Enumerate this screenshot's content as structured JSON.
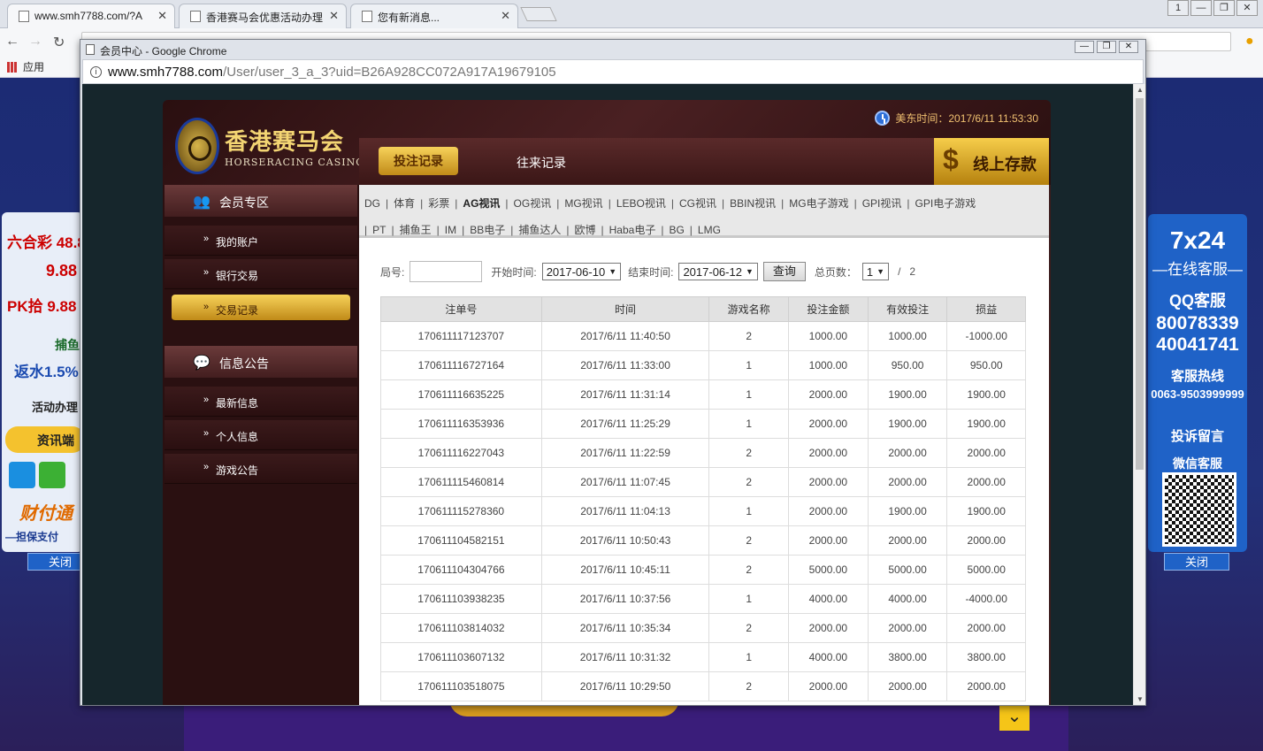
{
  "browser": {
    "tabs": [
      {
        "title": "www.smh7788.com/?A",
        "close": "✕"
      },
      {
        "title": "香港赛马会优惠活动办理",
        "close": "✕"
      },
      {
        "title": "您有新消息...",
        "close": "✕"
      }
    ],
    "bookmarks": {
      "apps_label": "应用"
    }
  },
  "popup": {
    "title": "会员中心 - Google Chrome",
    "url_host": "www.smh7788.com",
    "url_path": "/User/user_3_a_3?uid=B26A928CC072A917A19679105"
  },
  "header": {
    "logo_cn": "香港赛马会",
    "logo_en": "HORSERACING CASINO",
    "clock_text": "美东时间：2017/6/11 11:53:30",
    "tab_active": "投注记录",
    "tab_other": "往来记录",
    "deposit_label": "线上存款",
    "deposit_symbol": "$"
  },
  "sidebar": {
    "section1": "会员专区",
    "items1": [
      {
        "label": "我的账户",
        "arrow": "»"
      },
      {
        "label": "银行交易",
        "arrow": "»"
      },
      {
        "label": "交易记录",
        "arrow": "»"
      }
    ],
    "section2": "信息公告",
    "items2": [
      {
        "label": "最新信息",
        "arrow": "»"
      },
      {
        "label": "个人信息",
        "arrow": "»"
      },
      {
        "label": "游戏公告",
        "arrow": "»"
      }
    ]
  },
  "categories": [
    "DG",
    "体育",
    "彩票",
    "AG视讯",
    "OG视讯",
    "MG视讯",
    "LEBO视讯",
    "CG视讯",
    "BBIN视讯",
    "MG电子游戏",
    "GPI视讯",
    "GPI电子游戏",
    "PT",
    "捕鱼王",
    "IM",
    "BB电子",
    "捕鱼达人",
    "欧博",
    "Haba电子",
    "BG",
    "LMG"
  ],
  "category_sep": "|",
  "filter": {
    "round_label": "局号:",
    "start_label": "开始时间:",
    "start_value": "2017-06-10",
    "end_label": "结束时间:",
    "end_value": "2017-06-12",
    "query_button": "查询",
    "pages_label": "总页数：",
    "page_value": "1",
    "page_sep": "/",
    "page_total": "2",
    "dropdown_arrow": "▼"
  },
  "table": {
    "headers": [
      "注单号",
      "时间",
      "游戏名称",
      "投注金额",
      "有效投注",
      "损益"
    ],
    "rows": [
      [
        "170611117123707",
        "2017/6/11 11:40:50",
        "2",
        "1000.00",
        "1000.00",
        "-1000.00"
      ],
      [
        "170611116727164",
        "2017/6/11 11:33:00",
        "1",
        "1000.00",
        "950.00",
        "950.00"
      ],
      [
        "170611116635225",
        "2017/6/11 11:31:14",
        "1",
        "2000.00",
        "1900.00",
        "1900.00"
      ],
      [
        "170611116353936",
        "2017/6/11 11:25:29",
        "1",
        "2000.00",
        "1900.00",
        "1900.00"
      ],
      [
        "170611116227043",
        "2017/6/11 11:22:59",
        "2",
        "2000.00",
        "2000.00",
        "2000.00"
      ],
      [
        "170611115460814",
        "2017/6/11 11:07:45",
        "2",
        "2000.00",
        "2000.00",
        "2000.00"
      ],
      [
        "170611115278360",
        "2017/6/11 11:04:13",
        "1",
        "2000.00",
        "1900.00",
        "1900.00"
      ],
      [
        "170611104582151",
        "2017/6/11 10:50:43",
        "2",
        "2000.00",
        "2000.00",
        "2000.00"
      ],
      [
        "170611104304766",
        "2017/6/11 10:45:11",
        "2",
        "5000.00",
        "5000.00",
        "5000.00"
      ],
      [
        "170611103938235",
        "2017/6/11 10:37:56",
        "1",
        "4000.00",
        "4000.00",
        "-4000.00"
      ],
      [
        "170611103814032",
        "2017/6/11 10:35:34",
        "2",
        "2000.00",
        "2000.00",
        "2000.00"
      ],
      [
        "170611103607132",
        "2017/6/11 10:31:32",
        "1",
        "4000.00",
        "3800.00",
        "3800.00"
      ],
      [
        "170611103518075",
        "2017/6/11 10:29:50",
        "2",
        "2000.00",
        "2000.00",
        "2000.00"
      ]
    ]
  },
  "left_ad": {
    "lines": [
      "六合彩 48.8",
      "9.88",
      "PK拾 9.88",
      "捕鱼",
      "返水1.5%",
      "活动办理",
      "资讯端",
      "财付通",
      "—担保支付"
    ],
    "close": "关闭"
  },
  "right_ad": {
    "title": "7x24",
    "subtitle": "—在线客服—",
    "qq_label": "QQ客服",
    "qq1": "80078339",
    "qq2": "40041741",
    "hotline_label": "客服热线",
    "hotline": "0063-9503999999",
    "complaint": "投诉留言",
    "wechat": "微信客服",
    "close": "关闭"
  }
}
